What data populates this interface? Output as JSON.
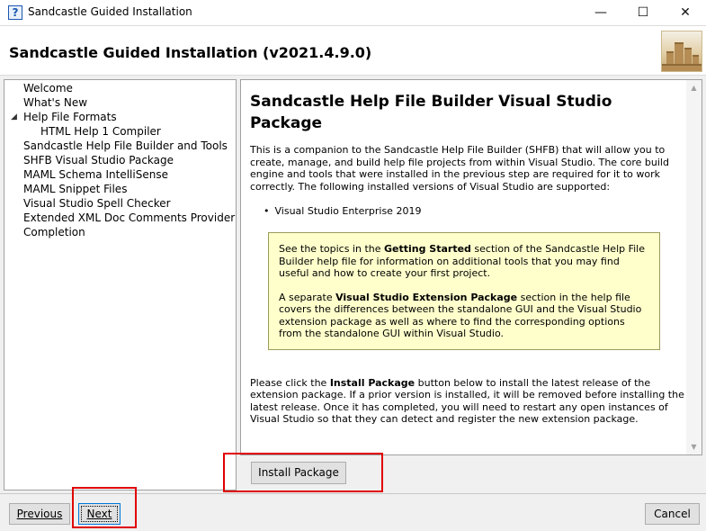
{
  "window": {
    "title": "Sandcastle Guided Installation",
    "icon_glyph": "?",
    "minimize_glyph": "—",
    "maximize_glyph": "☐",
    "close_glyph": "✕"
  },
  "header": {
    "title": "Sandcastle Guided Installation (v2021.4.9.0)"
  },
  "nav": {
    "expander_glyph": "◢",
    "items": [
      {
        "label": "Welcome"
      },
      {
        "label": "What's New"
      },
      {
        "label": "Help File Formats"
      },
      {
        "label": "HTML Help 1 Compiler"
      },
      {
        "label": "Sandcastle Help File Builder and Tools"
      },
      {
        "label": "SHFB Visual Studio Package"
      },
      {
        "label": "MAML Schema IntelliSense"
      },
      {
        "label": "MAML Snippet Files"
      },
      {
        "label": "Visual Studio Spell Checker"
      },
      {
        "label": "Extended XML Doc Comments Provider"
      },
      {
        "label": "Completion"
      }
    ],
    "selected": "SHFB Visual Studio Package"
  },
  "content": {
    "heading": "Sandcastle Help File Builder Visual Studio Package",
    "intro": "This is a companion to the Sandcastle Help File Builder (SHFB) that will allow you to create, manage, and build help file projects from within Visual Studio. The core build engine and tools that were installed in the previous step are required for it to work correctly. The following installed versions of Visual Studio are supported:",
    "versions": [
      "Visual Studio Enterprise 2019"
    ],
    "note": {
      "p1_before": "See the topics in the ",
      "p1_bold": "Getting Started",
      "p1_after": " section of the Sandcastle Help File Builder help file for information on additional tools that you may find useful and how to create your first project.",
      "p2_before": "A separate ",
      "p2_bold": "Visual Studio Extension Package",
      "p2_after": " section in the help file covers the differences between the standalone GUI and the Visual Studio extension package as well as where to find the corresponding options from the standalone GUI within Visual Studio."
    },
    "instructions_before": "Please click the ",
    "instructions_bold": "Install Package",
    "instructions_after": " button below to install the latest release of the extension package.  If a prior version is installed, it will be removed before installing the latest release.  Once it has completed, you will need to restart any open instances of Visual Studio so that they can detect and register the new extension package.",
    "scroll_up_glyph": "▲",
    "scroll_down_glyph": "▼"
  },
  "buttons": {
    "install": "Install Package",
    "previous": "Previous",
    "next": "Next",
    "cancel": "Cancel"
  },
  "colors": {
    "highlight": "#e00000",
    "note_background": "#ffffcc",
    "focus_border": "#0078d7"
  }
}
